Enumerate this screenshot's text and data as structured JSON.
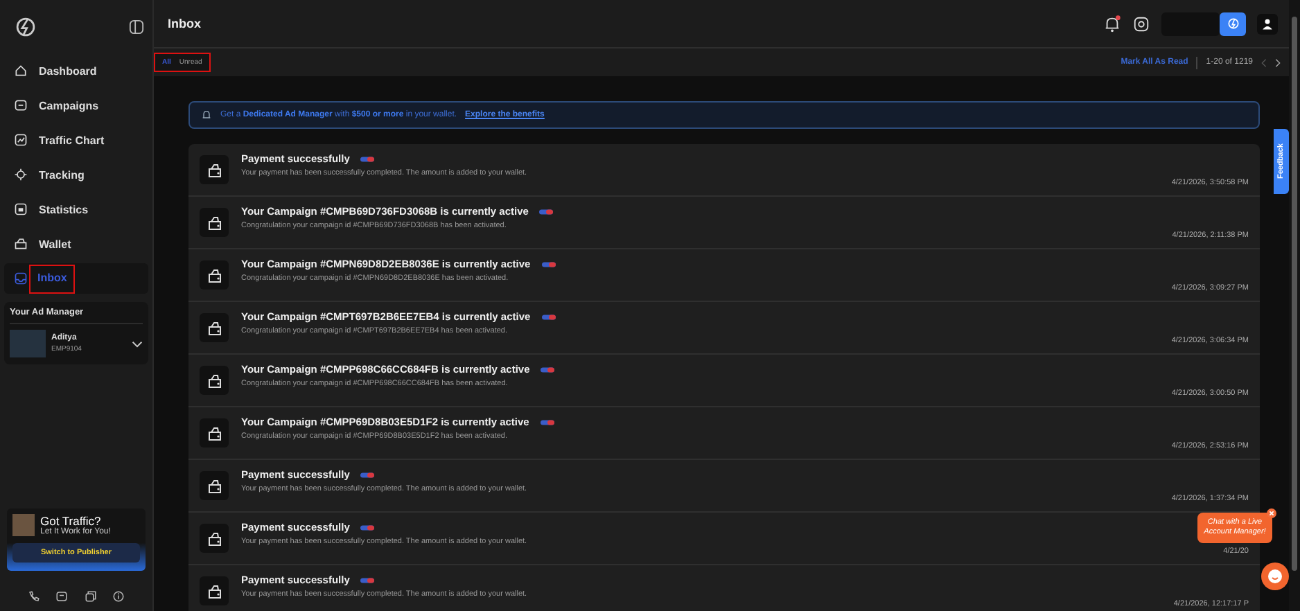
{
  "sidebar": {
    "nav": [
      {
        "label": "Dashboard",
        "selected": false,
        "annotated": false
      },
      {
        "label": "Campaigns",
        "selected": false,
        "annotated": false
      },
      {
        "label": "Traffic Chart",
        "selected": false,
        "annotated": false
      },
      {
        "label": "Tracking",
        "selected": false,
        "annotated": false
      },
      {
        "label": "Statistics",
        "selected": false,
        "annotated": false
      },
      {
        "label": "Wallet",
        "selected": false,
        "annotated": false
      },
      {
        "label": "Inbox",
        "selected": true,
        "annotated": true
      }
    ],
    "ad_manager": {
      "title": "Your Ad Manager",
      "name": "Aditya",
      "id": "EMP9104"
    },
    "promo": {
      "title": "Got Traffic?",
      "subtitle": "Let It Work for You!",
      "button": "Switch to Publisher"
    }
  },
  "header": {
    "title": "Inbox",
    "bell_unread": true
  },
  "tabs": [
    {
      "label": "All",
      "selected": true
    },
    {
      "label": "Unread",
      "selected": false
    }
  ],
  "tabs_annotated": true,
  "toolbar": {
    "mark_all": "Mark All As Read",
    "range": "1-20 of 1219"
  },
  "banner": {
    "text": "Get a **Dedicated Ad Manager** with **$500 or more** in your wallet.",
    "link": "Explore the benefits"
  },
  "notifications": [
    {
      "title": "Payment successfully",
      "message": "Your payment has been successfully completed. The amount is added to your wallet.",
      "time": "4/21/2026, 3:50:58 PM"
    },
    {
      "title": "Your Campaign #CMPB69D736FD3068B is currently active",
      "message": "Congratulation your campaign id #CMPB69D736FD3068B has been activated.",
      "time": "4/21/2026, 2:11:38 PM"
    },
    {
      "title": "Your Campaign #CMPN69D8D2EB8036E is currently active",
      "message": "Congratulation your campaign id #CMPN69D8D2EB8036E has been activated.",
      "time": "4/21/2026, 3:09:27 PM"
    },
    {
      "title": "Your Campaign #CMPT697B2B6EE7EB4 is currently active",
      "message": "Congratulation your campaign id #CMPT697B2B6EE7EB4 has been activated.",
      "time": "4/21/2026, 3:06:34 PM"
    },
    {
      "title": "Your Campaign #CMPP698C66CC684FB is currently active",
      "message": "Congratulation your campaign id #CMPP698C66CC684FB has been activated.",
      "time": "4/21/2026, 3:00:50 PM"
    },
    {
      "title": "Your Campaign #CMPP69D8B03E5D1F2 is currently active",
      "message": "Congratulation your campaign id #CMPP69D8B03E5D1F2 has been activated.",
      "time": "4/21/2026, 2:53:16 PM"
    },
    {
      "title": "Payment successfully",
      "message": "Your payment has been successfully completed. The amount is added to your wallet.",
      "time": "4/21/2026, 1:37:34 PM"
    },
    {
      "title": "Payment successfully",
      "message": "Your payment has been successfully completed. The amount is added to your wallet.",
      "time": "4/21/20"
    },
    {
      "title": "Payment successfully",
      "message": "Your payment has been successfully completed. The amount is added to your wallet.",
      "time": "4/21/2026, 12:17:17 P"
    }
  ],
  "feedback": "Feedback",
  "chat": {
    "bubble": "Chat with a Live Account Manager!"
  }
}
